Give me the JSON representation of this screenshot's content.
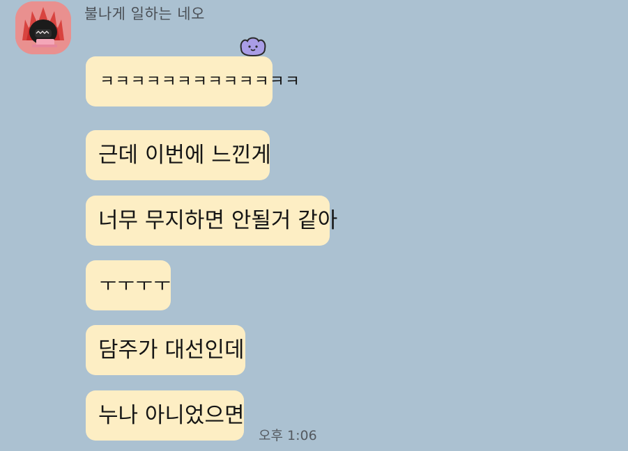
{
  "sender": {
    "name": "불나게 일하는 네오"
  },
  "messages": [
    {
      "text": "ㅋㅋㅋㅋㅋㅋㅋㅋㅋㅋㅋㅋㅋ"
    },
    {
      "text": "근데 이번에 느낀게"
    },
    {
      "text": "너무 무지하면 안될거 같아"
    },
    {
      "text": "ㅜㅜㅜㅜ"
    },
    {
      "text": "담주가 대선인데"
    },
    {
      "text": "누나 아니었으면"
    }
  ],
  "timestamp": "오후 1:06",
  "colors": {
    "background": "#abc1d1",
    "bubble": "#fdeec4",
    "avatar_bg": "#e9908f",
    "reaction_badge": "#a99de6"
  },
  "icons": {
    "avatar": "profile-avatar-icon",
    "reaction": "blob-emoticon-icon"
  }
}
